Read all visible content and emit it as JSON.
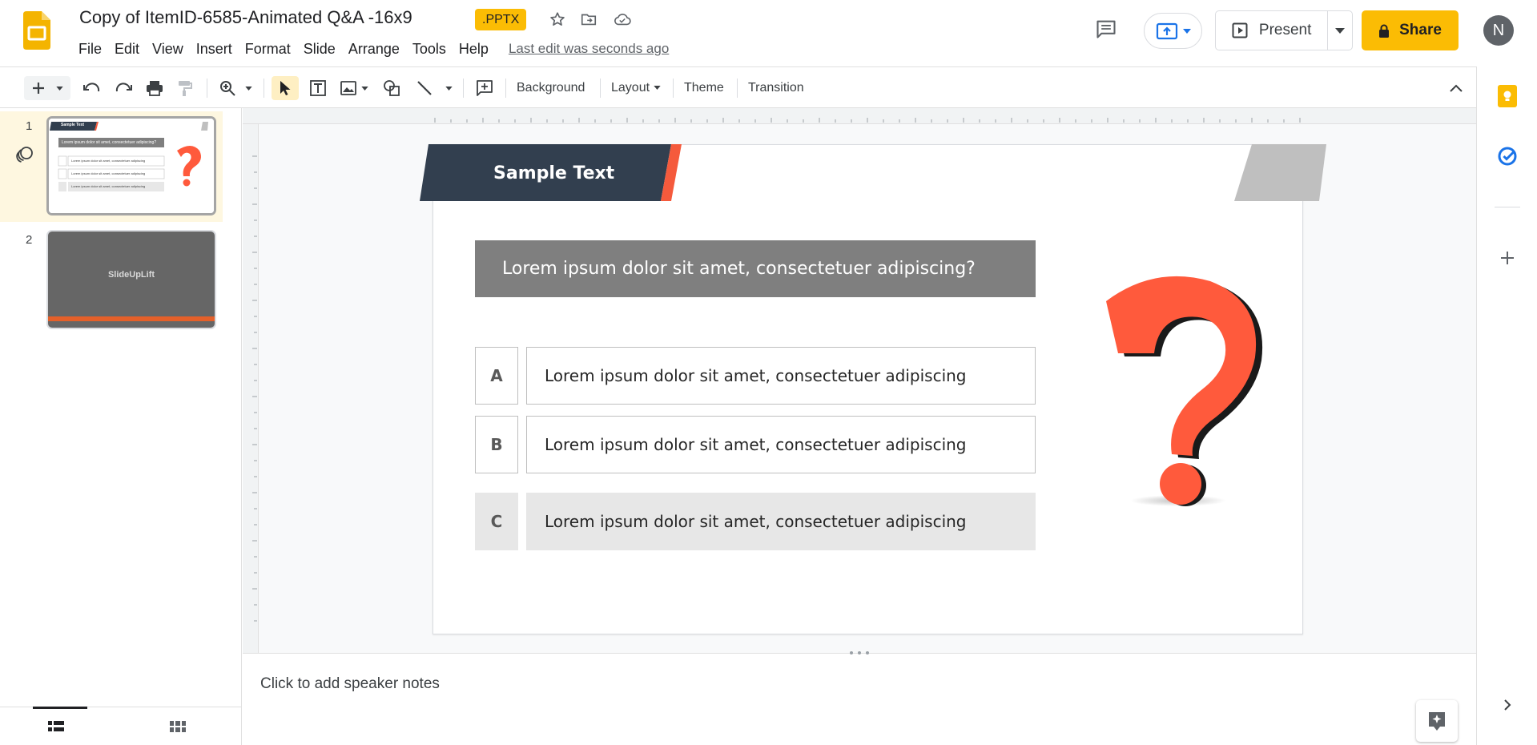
{
  "header": {
    "doc_title": "Copy of ItemID-6585-Animated Q&A -16x9",
    "badge": ".PPTX",
    "last_edit": "Last edit was seconds ago",
    "present_label": "Present",
    "share_label": "Share",
    "avatar_initial": "N",
    "brand_color": "#fbbc04",
    "icons": [
      "slides-logo-icon",
      "star-icon",
      "move-folder-icon",
      "cloud-saved-icon",
      "comment-icon",
      "meet-present-icon",
      "present-icon",
      "chevron-down-icon",
      "lock-icon"
    ]
  },
  "menu": [
    "File",
    "Edit",
    "View",
    "Insert",
    "Format",
    "Slide",
    "Arrange",
    "Tools",
    "Help"
  ],
  "toolbar": {
    "background": "Background",
    "layout": "Layout",
    "theme": "Theme",
    "transition": "Transition"
  },
  "filmstrip": {
    "slides": [
      {
        "number": "1",
        "selected": true
      },
      {
        "number": "2",
        "selected": false,
        "title": "SlideUpLift"
      }
    ]
  },
  "slide": {
    "header_text": "Sample Text",
    "question": "Lorem ipsum dolor sit amet, consectetuer adipiscing?",
    "options": [
      {
        "letter": "A",
        "text": "Lorem ipsum dolor sit amet, consectetuer adipiscing",
        "highlighted": false
      },
      {
        "letter": "B",
        "text": "Lorem ipsum dolor sit amet, consectetuer adipiscing",
        "highlighted": false
      },
      {
        "letter": "C",
        "text": "Lorem ipsum dolor sit amet, consectetuer adipiscing",
        "highlighted": true
      }
    ],
    "colors": {
      "header": "#323f4f",
      "accent": "#f55a3c",
      "question_bg": "#7f7f7f",
      "qmark": "#ff5a3c"
    }
  },
  "thumb1": {
    "header_text": "Sample Text",
    "question": "Lorem ipsum dolor sit amet, consectetuer adipiscing?",
    "option": "Lorem ipsum dolor sit amet, consectetuer adipiscing"
  },
  "notes": {
    "placeholder": "Click to add speaker notes"
  }
}
